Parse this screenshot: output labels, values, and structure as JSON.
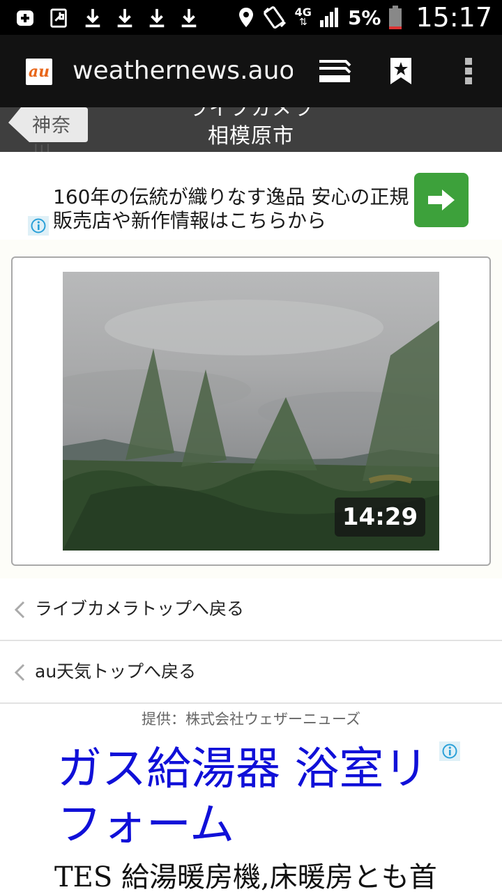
{
  "status_bar": {
    "battery_percent": "5%",
    "network": "4G",
    "time": "15:17"
  },
  "toolbar": {
    "logo_text": "au",
    "url": "weathernews.auone"
  },
  "page_header": {
    "back_label": "神奈川",
    "subtitle": "ライブカメラ",
    "title": "相模原市"
  },
  "ad1": {
    "text": "160年の伝統が織りなす逸品 安心の正規販売店や新作情報はこちらから"
  },
  "camera": {
    "timestamp": "14:29"
  },
  "nav": {
    "link1": "ライブカメラトップへ戻る",
    "link2": "au天気トップへ戻る"
  },
  "provider": "提供：株式会社ウェザーニューズ",
  "ad2": {
    "title": "ガス給湯器 浴室リフォーム",
    "description": "TES 給湯暖房機,床暖房とも首"
  },
  "colors": {
    "ad_button": "#3da13b",
    "ad_title": "#1010d8",
    "header_bg": "#3f3f3f"
  }
}
